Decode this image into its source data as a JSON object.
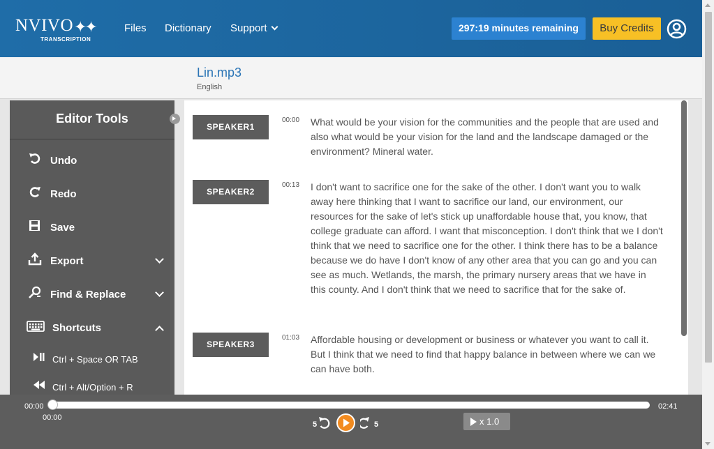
{
  "header": {
    "logo_main": "NVIVO",
    "logo_sub": "TRANSCRIPTION",
    "nav": {
      "files": "Files",
      "dictionary": "Dictionary",
      "support": "Support"
    },
    "minutes_remaining": "297:19 minutes remaining",
    "buy_credits": "Buy Credits"
  },
  "file": {
    "name": "Lin.mp3",
    "language": "English"
  },
  "editor_tools": {
    "title": "Editor Tools",
    "items": [
      {
        "label": "Undo",
        "icon": "undo-icon"
      },
      {
        "label": "Redo",
        "icon": "redo-icon"
      },
      {
        "label": "Save",
        "icon": "save-icon"
      },
      {
        "label": "Export",
        "icon": "export-icon"
      },
      {
        "label": "Find & Replace",
        "icon": "find-replace-icon"
      },
      {
        "label": "Shortcuts",
        "icon": "keyboard-icon"
      }
    ],
    "shortcuts": [
      {
        "label": "Ctrl + Space  OR  TAB",
        "icon": "play-pause-icon"
      },
      {
        "label": "Ctrl + Alt/Option + R",
        "icon": "rewind-icon"
      }
    ]
  },
  "transcript": [
    {
      "speaker": "SPEAKER1",
      "time": "00:00",
      "text": "What would be your vision for the communities and the people that are used and also what would be your vision for the land and the landscape damaged or the environment? Mineral water."
    },
    {
      "speaker": "SPEAKER2",
      "time": "00:13",
      "text": "I don't want to sacrifice one for the sake of the other. I don't want you to walk away here thinking that I want to sacrifice our land, our environment, our resources for the sake of let's stick up unaffordable house that, you know, that college graduate can afford. I want that misconception. I don't think that we I don't think that we need to sacrifice one for the other. I think there has to be a balance because we do have I don't know of any other area that you can go and you can see as much. Wetlands, the marsh, the primary nursery areas that we have in this county. And I don't think that we need to sacrifice that for the sake of."
    },
    {
      "speaker": "SPEAKER3",
      "time": "01:03",
      "text": "Affordable housing or development or business or whatever you want to call it. But I think that we need to find that happy balance in between where we can we can have both."
    }
  ],
  "player": {
    "start_time": "00:00",
    "current_time": "00:00",
    "end_time": "02:41",
    "progress": 0,
    "rewind_seconds": "5",
    "forward_seconds": "5",
    "speed": "x 1.0"
  },
  "colors": {
    "header_bg": "#1f6da8",
    "minutes_bg": "#2c82d1",
    "buy_bg": "#f7c025",
    "sidebar_bg": "#5a5a5a",
    "speaker_bg": "#5c5c5c",
    "play_bg": "#f28b20",
    "filename": "#2a74b5"
  }
}
